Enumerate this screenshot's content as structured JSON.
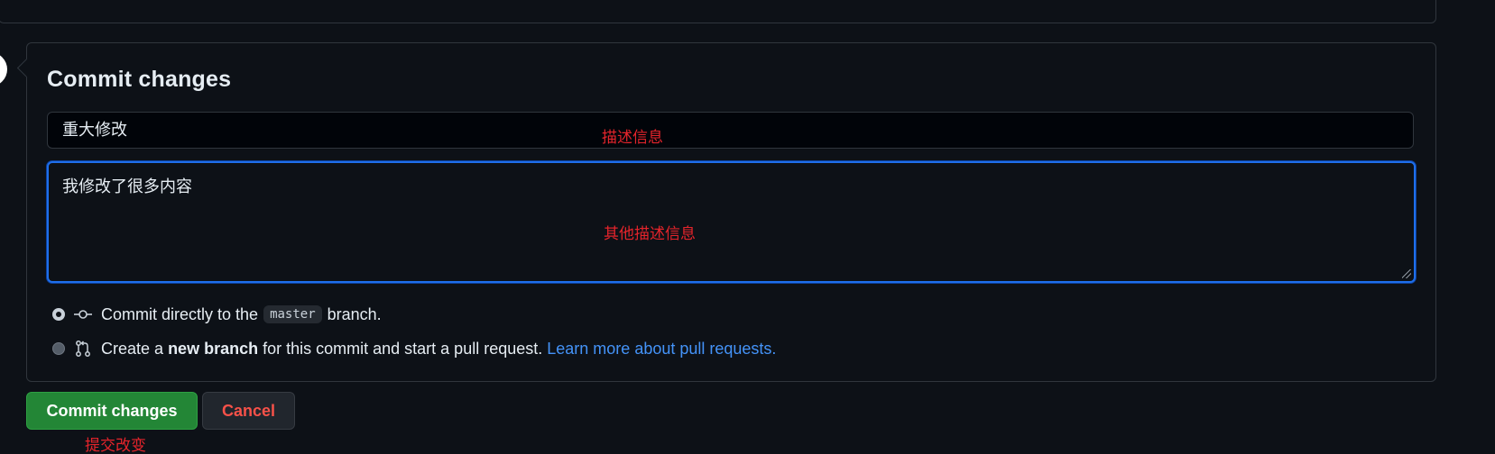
{
  "form": {
    "title": "Commit changes",
    "summary_value": "重大修改",
    "description_value": "我修改了很多内容"
  },
  "options": {
    "direct": {
      "prefix": "Commit directly to the",
      "branch": "master",
      "suffix": "branch.",
      "checked": true
    },
    "new_branch": {
      "prefix": "Create a",
      "bold": "new branch",
      "middle": "for this commit and start a pull request.",
      "link": "Learn more about pull requests.",
      "checked": false
    }
  },
  "buttons": {
    "commit_label": "Commit changes",
    "cancel_label": "Cancel"
  },
  "annotations": {
    "summary_note": "描述信息",
    "description_note": "其他描述信息",
    "commit_note": "提交改变"
  },
  "icons": {
    "direct": "git-commit-icon",
    "new_branch": "git-pull-request-icon"
  },
  "colors": {
    "background": "#0d1117",
    "commit_button": "#238636",
    "cancel_text": "#f85149",
    "link": "#4493f8",
    "focus_border": "#1f6feb",
    "annotation": "#e5242b"
  }
}
